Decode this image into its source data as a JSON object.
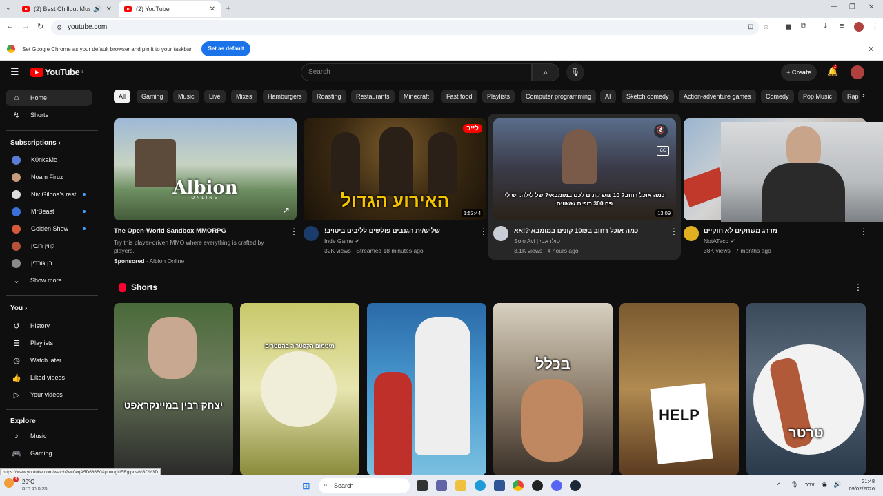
{
  "browser": {
    "tabs": [
      {
        "label": "(2) Best Chillout Music 🎵 ",
        "active": false
      },
      {
        "label": "(2) YouTube",
        "active": true
      }
    ],
    "url": "youtube.com",
    "infobar_text": "Set Google Chrome as your default browser and pin it to your taskbar",
    "infobar_button": "Set as default"
  },
  "youtube": {
    "logo_text": "YouTube",
    "logo_region": "IL",
    "search_placeholder": "Search",
    "create_label": "Create",
    "notification_count": "2"
  },
  "sidebar": {
    "main": [
      {
        "label": "Home",
        "icon": "home-icon",
        "active": true
      },
      {
        "label": "Shorts",
        "icon": "shorts-icon",
        "active": false
      }
    ],
    "subscriptions_heading": "Subscriptions",
    "subscriptions": [
      {
        "label": "K0nkaMc",
        "color": "#5b7bd6",
        "dot": false
      },
      {
        "label": "Noam Firuz",
        "color": "#c89b7b",
        "dot": false
      },
      {
        "label": "Niv Gilboa's rest...",
        "color": "#dddddd",
        "dot": true
      },
      {
        "label": "MrBeast",
        "color": "#3a6fd8",
        "dot": true
      },
      {
        "label": "Golden Show",
        "color": "#d65a3a",
        "dot": true
      },
      {
        "label": "קווין רובין",
        "color": "#b5533a",
        "dot": false
      },
      {
        "label": "בן גורדין",
        "color": "#8a8a8a",
        "dot": false
      }
    ],
    "show_more": "Show more",
    "you_heading": "You",
    "you_items": [
      {
        "label": "History",
        "icon": "history-icon"
      },
      {
        "label": "Playlists",
        "icon": "playlists-icon"
      },
      {
        "label": "Watch later",
        "icon": "watch-later-icon"
      },
      {
        "label": "Liked videos",
        "icon": "thumbs-up-icon"
      },
      {
        "label": "Your videos",
        "icon": "your-videos-icon"
      }
    ],
    "explore_heading": "Explore",
    "explore_items": [
      {
        "label": "Music",
        "icon": "music-icon"
      },
      {
        "label": "Gaming",
        "icon": "gaming-icon"
      }
    ]
  },
  "chips": [
    "All",
    "Gaming",
    "Music",
    "Live",
    "Mixes",
    "Hamburgers",
    "Roasting",
    "Restaurants",
    "Minecraft",
    "Fast food",
    "Playlists",
    "Computer programming",
    "AI",
    "Sketch comedy",
    "Action-adventure games",
    "Comedy",
    "Pop Music",
    "Rap"
  ],
  "videos": [
    {
      "title": "The Open-World Sandbox MMORPG",
      "description": "Try this player-driven MMO where everything is crafted by players.",
      "sponsored": "Sponsored",
      "channel": "Albion Online",
      "thumb_text": "Albion",
      "thumb_sub": "ONLINE"
    },
    {
      "title": "!שליש/ית הגנבים פולשים לליבים ביטויב",
      "channel": "Inde Game",
      "meta": "32K views · Streamed 18 minutes ago",
      "duration": "1:53:44",
      "thumb_text": "האירוע הגדול",
      "badge": "לייב"
    },
    {
      "title": "כמה אוכל רחוב ב10₪ קונים במומבאי?!אא",
      "channel": "Solo Avi | סולו אבי",
      "meta": "3.1K views · 4 hours ago",
      "duration": "13:09",
      "thumb_text": "כמה אוכל רחוב? 10 ₪ש קונים לכם במומבאי? של לילה. יש לי פה 300 רופים ששווים"
    },
    {
      "title": "מדרג משחקים לא חוקיים",
      "channel": "NotATaco",
      "meta": "38K views · 7 months ago"
    }
  ],
  "shorts_heading": "Shorts",
  "shorts": [
    {
      "caption": "יצחק רבין במיינקראפט"
    },
    {
      "caption": "מינימום הקפטריה בהנוטרים"
    },
    {
      "caption": ""
    },
    {
      "caption": "בכלל"
    },
    {
      "caption": "HELP"
    },
    {
      "caption": "טרטר"
    }
  ],
  "status_url": "https://www.youtube.com/watch?v=0eqA5D666F0&pp=ugUEEgIpdw%3D%3D",
  "taskbar": {
    "weather_temp": "20°C",
    "weather_desc": "מעונן רב היום",
    "search_label": "Search",
    "language": "עבר",
    "time": "21:48",
    "date": "09/02/2026",
    "weather_badge": "4"
  }
}
